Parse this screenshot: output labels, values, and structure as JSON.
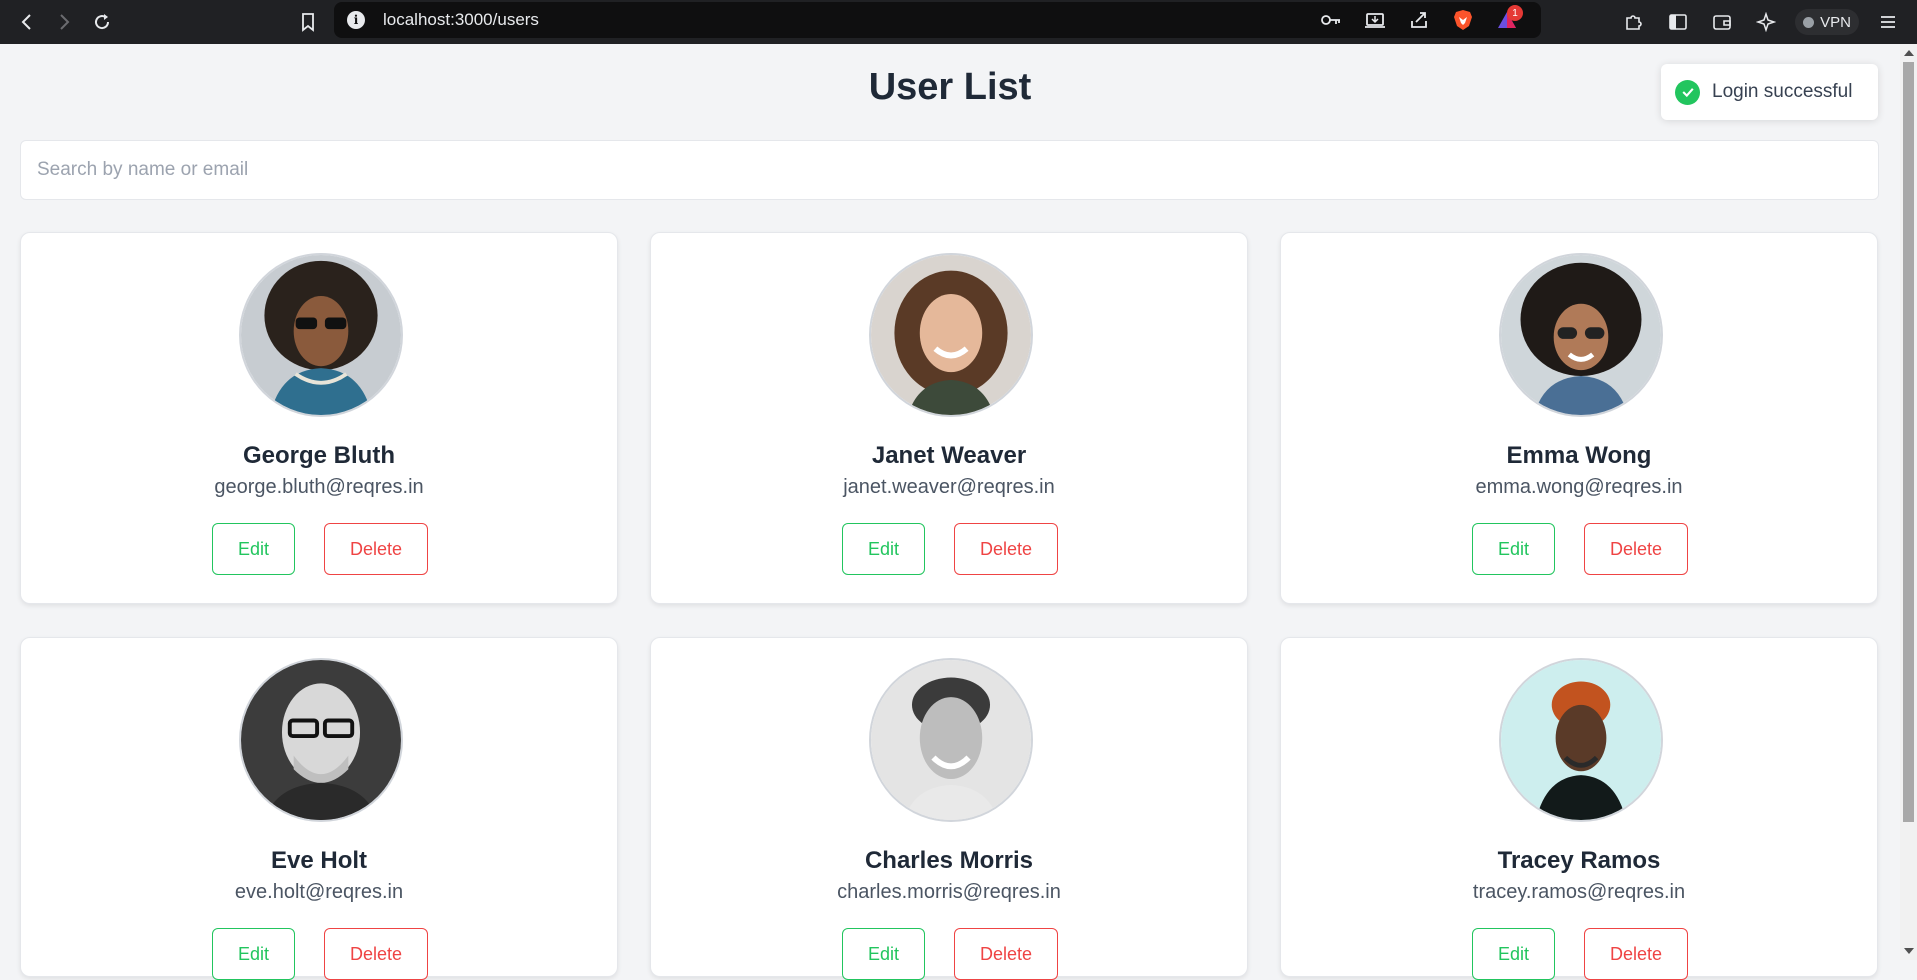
{
  "browser": {
    "url": "localhost:3000/users",
    "notification_count": "1",
    "vpn_label": "VPN"
  },
  "page": {
    "title": "User List",
    "toast": "Login successful",
    "search_placeholder": "Search by name or email",
    "search_value": ""
  },
  "users": [
    {
      "name": "George Bluth",
      "email": "george.bluth@reqres.in",
      "edit": "Edit",
      "delete": "Delete"
    },
    {
      "name": "Janet Weaver",
      "email": "janet.weaver@reqres.in",
      "edit": "Edit",
      "delete": "Delete"
    },
    {
      "name": "Emma Wong",
      "email": "emma.wong@reqres.in",
      "edit": "Edit",
      "delete": "Delete"
    },
    {
      "name": "Eve Holt",
      "email": "eve.holt@reqres.in",
      "edit": "Edit",
      "delete": "Delete"
    },
    {
      "name": "Charles Morris",
      "email": "charles.morris@reqres.in",
      "edit": "Edit",
      "delete": "Delete"
    },
    {
      "name": "Tracey Ramos",
      "email": "tracey.ramos@reqres.in",
      "edit": "Edit",
      "delete": "Delete"
    }
  ],
  "colors": {
    "edit": "#22c55e",
    "delete": "#ef4444",
    "success": "#22c55e",
    "background": "#f3f4f6"
  }
}
